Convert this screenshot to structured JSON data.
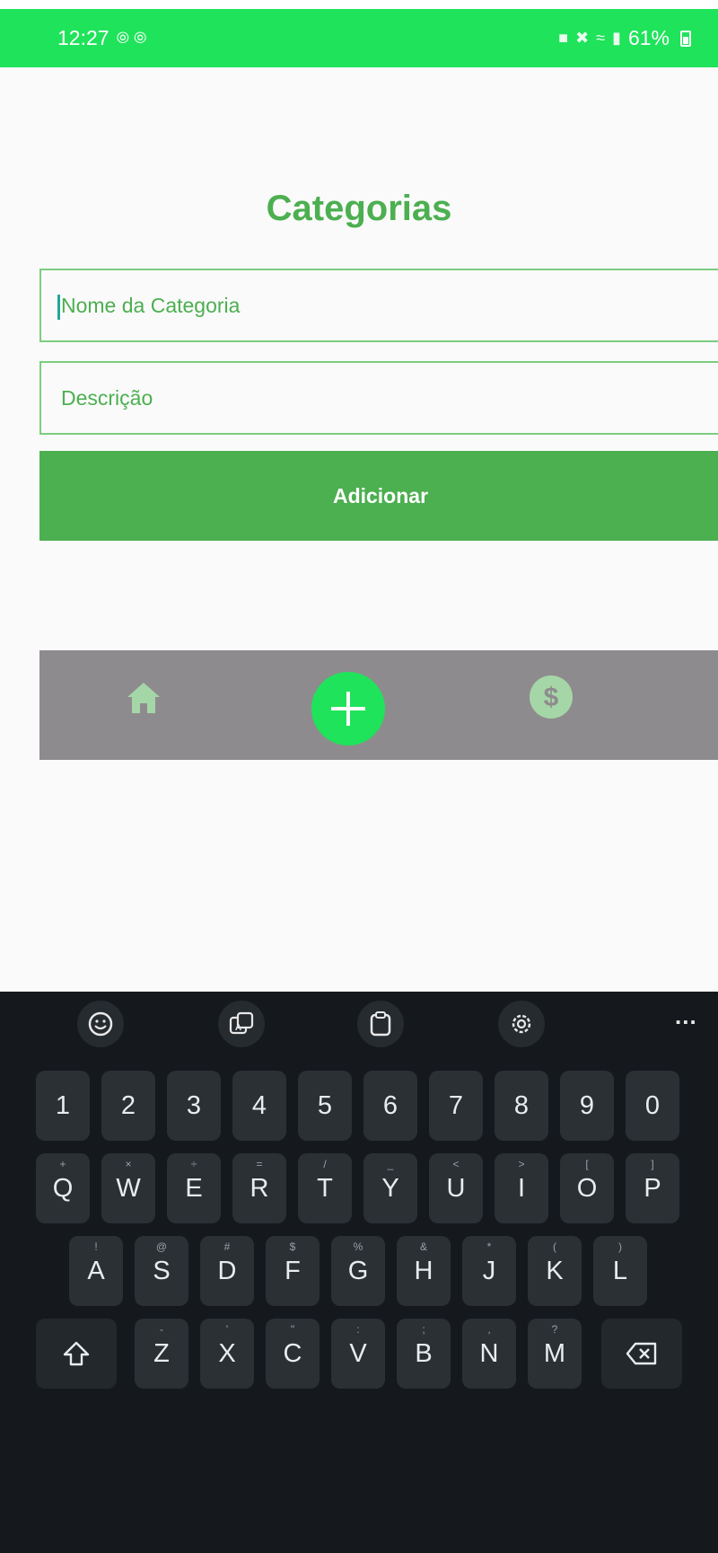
{
  "status_bar": {
    "time": "12:27",
    "notif_icons": "⦾ ⦾",
    "battery_pct": "61%"
  },
  "page": {
    "title": "Categorias",
    "name_field": {
      "placeholder": "Nome da Categoria",
      "value": ""
    },
    "description_field": {
      "placeholder": "Descrição",
      "value": ""
    },
    "add_button": "Adicionar"
  },
  "bottom_nav": {
    "items": [
      {
        "icon": "home-icon"
      },
      {
        "icon": "plus-icon"
      },
      {
        "icon": "dollar-icon"
      }
    ],
    "colors": {
      "background": "#8e8b8e",
      "active": "#1fe35a",
      "inactive": "#a5d6a7"
    }
  },
  "keyboard": {
    "toolbar": [
      "emoji-icon",
      "translate-icon",
      "clipboard-icon",
      "settings-icon",
      "more-icon"
    ],
    "more_label": "...",
    "number_row": [
      "1",
      "2",
      "3",
      "4",
      "5",
      "6",
      "7",
      "8",
      "9",
      "0"
    ],
    "row1": [
      "Q",
      "W",
      "E",
      "R",
      "T",
      "Y",
      "U",
      "I",
      "O",
      "P"
    ],
    "row1_hints": [
      "+",
      "×",
      "÷",
      "=",
      "/",
      "_",
      "<",
      ">",
      "[",
      "]"
    ],
    "row2": [
      "A",
      "S",
      "D",
      "F",
      "G",
      "H",
      "J",
      "K",
      "L"
    ],
    "row2_hints": [
      "!",
      "@",
      "#",
      "$",
      "%",
      "&",
      "*",
      "(",
      ")"
    ],
    "row3": [
      "Z",
      "X",
      "C",
      "V",
      "B",
      "N",
      "M"
    ],
    "row3_hints": [
      "-",
      "'",
      "\"",
      ":",
      ";",
      ",",
      "?"
    ]
  },
  "colors": {
    "accent": "#4caf50",
    "status_bar": "#1fe35a",
    "keyboard_bg": "#15191d",
    "key_bg": "#2b3035"
  }
}
